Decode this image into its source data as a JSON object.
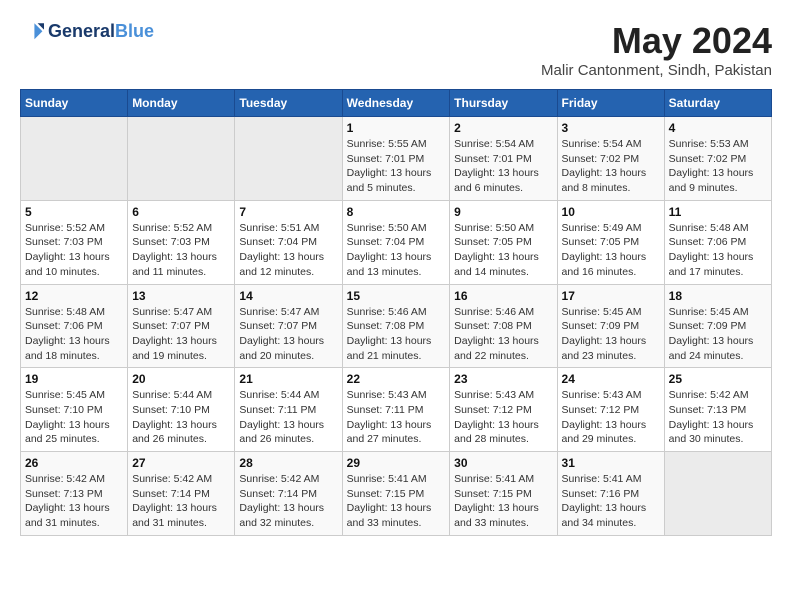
{
  "header": {
    "logo_line1": "General",
    "logo_line2": "Blue",
    "month": "May 2024",
    "location": "Malir Cantonment, Sindh, Pakistan"
  },
  "weekdays": [
    "Sunday",
    "Monday",
    "Tuesday",
    "Wednesday",
    "Thursday",
    "Friday",
    "Saturday"
  ],
  "weeks": [
    [
      {
        "day": "",
        "info": ""
      },
      {
        "day": "",
        "info": ""
      },
      {
        "day": "",
        "info": ""
      },
      {
        "day": "1",
        "info": "Sunrise: 5:55 AM\nSunset: 7:01 PM\nDaylight: 13 hours\nand 5 minutes."
      },
      {
        "day": "2",
        "info": "Sunrise: 5:54 AM\nSunset: 7:01 PM\nDaylight: 13 hours\nand 6 minutes."
      },
      {
        "day": "3",
        "info": "Sunrise: 5:54 AM\nSunset: 7:02 PM\nDaylight: 13 hours\nand 8 minutes."
      },
      {
        "day": "4",
        "info": "Sunrise: 5:53 AM\nSunset: 7:02 PM\nDaylight: 13 hours\nand 9 minutes."
      }
    ],
    [
      {
        "day": "5",
        "info": "Sunrise: 5:52 AM\nSunset: 7:03 PM\nDaylight: 13 hours\nand 10 minutes."
      },
      {
        "day": "6",
        "info": "Sunrise: 5:52 AM\nSunset: 7:03 PM\nDaylight: 13 hours\nand 11 minutes."
      },
      {
        "day": "7",
        "info": "Sunrise: 5:51 AM\nSunset: 7:04 PM\nDaylight: 13 hours\nand 12 minutes."
      },
      {
        "day": "8",
        "info": "Sunrise: 5:50 AM\nSunset: 7:04 PM\nDaylight: 13 hours\nand 13 minutes."
      },
      {
        "day": "9",
        "info": "Sunrise: 5:50 AM\nSunset: 7:05 PM\nDaylight: 13 hours\nand 14 minutes."
      },
      {
        "day": "10",
        "info": "Sunrise: 5:49 AM\nSunset: 7:05 PM\nDaylight: 13 hours\nand 16 minutes."
      },
      {
        "day": "11",
        "info": "Sunrise: 5:48 AM\nSunset: 7:06 PM\nDaylight: 13 hours\nand 17 minutes."
      }
    ],
    [
      {
        "day": "12",
        "info": "Sunrise: 5:48 AM\nSunset: 7:06 PM\nDaylight: 13 hours\nand 18 minutes."
      },
      {
        "day": "13",
        "info": "Sunrise: 5:47 AM\nSunset: 7:07 PM\nDaylight: 13 hours\nand 19 minutes."
      },
      {
        "day": "14",
        "info": "Sunrise: 5:47 AM\nSunset: 7:07 PM\nDaylight: 13 hours\nand 20 minutes."
      },
      {
        "day": "15",
        "info": "Sunrise: 5:46 AM\nSunset: 7:08 PM\nDaylight: 13 hours\nand 21 minutes."
      },
      {
        "day": "16",
        "info": "Sunrise: 5:46 AM\nSunset: 7:08 PM\nDaylight: 13 hours\nand 22 minutes."
      },
      {
        "day": "17",
        "info": "Sunrise: 5:45 AM\nSunset: 7:09 PM\nDaylight: 13 hours\nand 23 minutes."
      },
      {
        "day": "18",
        "info": "Sunrise: 5:45 AM\nSunset: 7:09 PM\nDaylight: 13 hours\nand 24 minutes."
      }
    ],
    [
      {
        "day": "19",
        "info": "Sunrise: 5:45 AM\nSunset: 7:10 PM\nDaylight: 13 hours\nand 25 minutes."
      },
      {
        "day": "20",
        "info": "Sunrise: 5:44 AM\nSunset: 7:10 PM\nDaylight: 13 hours\nand 26 minutes."
      },
      {
        "day": "21",
        "info": "Sunrise: 5:44 AM\nSunset: 7:11 PM\nDaylight: 13 hours\nand 26 minutes."
      },
      {
        "day": "22",
        "info": "Sunrise: 5:43 AM\nSunset: 7:11 PM\nDaylight: 13 hours\nand 27 minutes."
      },
      {
        "day": "23",
        "info": "Sunrise: 5:43 AM\nSunset: 7:12 PM\nDaylight: 13 hours\nand 28 minutes."
      },
      {
        "day": "24",
        "info": "Sunrise: 5:43 AM\nSunset: 7:12 PM\nDaylight: 13 hours\nand 29 minutes."
      },
      {
        "day": "25",
        "info": "Sunrise: 5:42 AM\nSunset: 7:13 PM\nDaylight: 13 hours\nand 30 minutes."
      }
    ],
    [
      {
        "day": "26",
        "info": "Sunrise: 5:42 AM\nSunset: 7:13 PM\nDaylight: 13 hours\nand 31 minutes."
      },
      {
        "day": "27",
        "info": "Sunrise: 5:42 AM\nSunset: 7:14 PM\nDaylight: 13 hours\nand 31 minutes."
      },
      {
        "day": "28",
        "info": "Sunrise: 5:42 AM\nSunset: 7:14 PM\nDaylight: 13 hours\nand 32 minutes."
      },
      {
        "day": "29",
        "info": "Sunrise: 5:41 AM\nSunset: 7:15 PM\nDaylight: 13 hours\nand 33 minutes."
      },
      {
        "day": "30",
        "info": "Sunrise: 5:41 AM\nSunset: 7:15 PM\nDaylight: 13 hours\nand 33 minutes."
      },
      {
        "day": "31",
        "info": "Sunrise: 5:41 AM\nSunset: 7:16 PM\nDaylight: 13 hours\nand 34 minutes."
      },
      {
        "day": "",
        "info": ""
      }
    ]
  ]
}
